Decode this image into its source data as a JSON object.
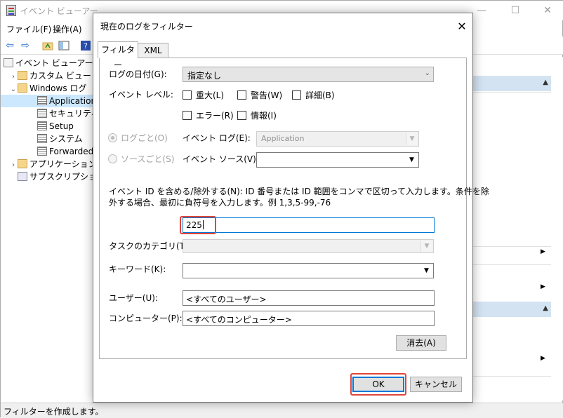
{
  "main_window": {
    "title": "イベント ビューアー",
    "menu": [
      "ファイル(F)",
      "操作(A)"
    ],
    "tree": [
      {
        "label": "イベント ビューアー (ロー",
        "chevron": "",
        "icon": "app"
      },
      {
        "label": "カスタム ビュー",
        "chevron": "›",
        "icon": "folder"
      },
      {
        "label": "Windows ログ",
        "chevron": "⌄",
        "icon": "folder"
      },
      {
        "label": "Application",
        "chevron": "",
        "icon": "log",
        "selected": true
      },
      {
        "label": "セキュリティ",
        "chevron": "",
        "icon": "log"
      },
      {
        "label": "Setup",
        "chevron": "",
        "icon": "log"
      },
      {
        "label": "システム",
        "chevron": "",
        "icon": "log"
      },
      {
        "label": "Forwarded Ev",
        "chevron": "",
        "icon": "log"
      },
      {
        "label": "アプリケーションとサ",
        "chevron": "›",
        "icon": "folder"
      },
      {
        "label": "サブスクリプション",
        "chevron": "",
        "icon": "sub"
      }
    ],
    "status": "フィルターを作成します。"
  },
  "dialog": {
    "title": "現在のログをフィルター",
    "tabs": {
      "filter": "フィルター",
      "xml": "XML"
    },
    "logged_label": "ログの日付(G):",
    "logged_value": "指定なし",
    "level_label": "イベント レベル:",
    "levels": {
      "critical": "重大(L)",
      "warning": "警告(W)",
      "verbose": "詳細(B)",
      "error": "エラー(R)",
      "info": "情報(I)"
    },
    "by_log_label": "ログごと(O)",
    "by_source_label": "ソースごと(S)",
    "event_log_label": "イベント ログ(E):",
    "event_log_value": "Application",
    "event_source_label": "イベント ソース(V):",
    "event_source_value": "",
    "event_id_desc_1": "イベント ID を含める/除外する(N): ID 番号または ID 範囲をコンマで区切って入力します。条件を除",
    "event_id_desc_2": "外する場合、最初に負符号を入力します。例 1,3,5-99,-76",
    "event_id_value": "225",
    "task_category_label": "タスクのカテゴリ(T):",
    "keywords_label": "キーワード(K):",
    "user_label": "ユーザー(U):",
    "user_value": "<すべてのユーザー>",
    "computer_label": "コンピューター(P):",
    "computer_value": "<すべてのコンピューター>",
    "clear_button": "消去(A)",
    "ok_button": "OK",
    "cancel_button": "キャンセル"
  },
  "icons": {
    "close": "✕",
    "minimize": "—",
    "maximize": "☐",
    "dropdown": "⌄",
    "combo_arrow": "▼",
    "back": "⇦",
    "forward": "⇨",
    "expand": "▶",
    "collapse": "▲"
  },
  "colors": {
    "highlight_box": "#e0463a",
    "selection": "#cce8ff",
    "focus_border": "#0078d7",
    "actions_header": "#d3e3f1"
  }
}
